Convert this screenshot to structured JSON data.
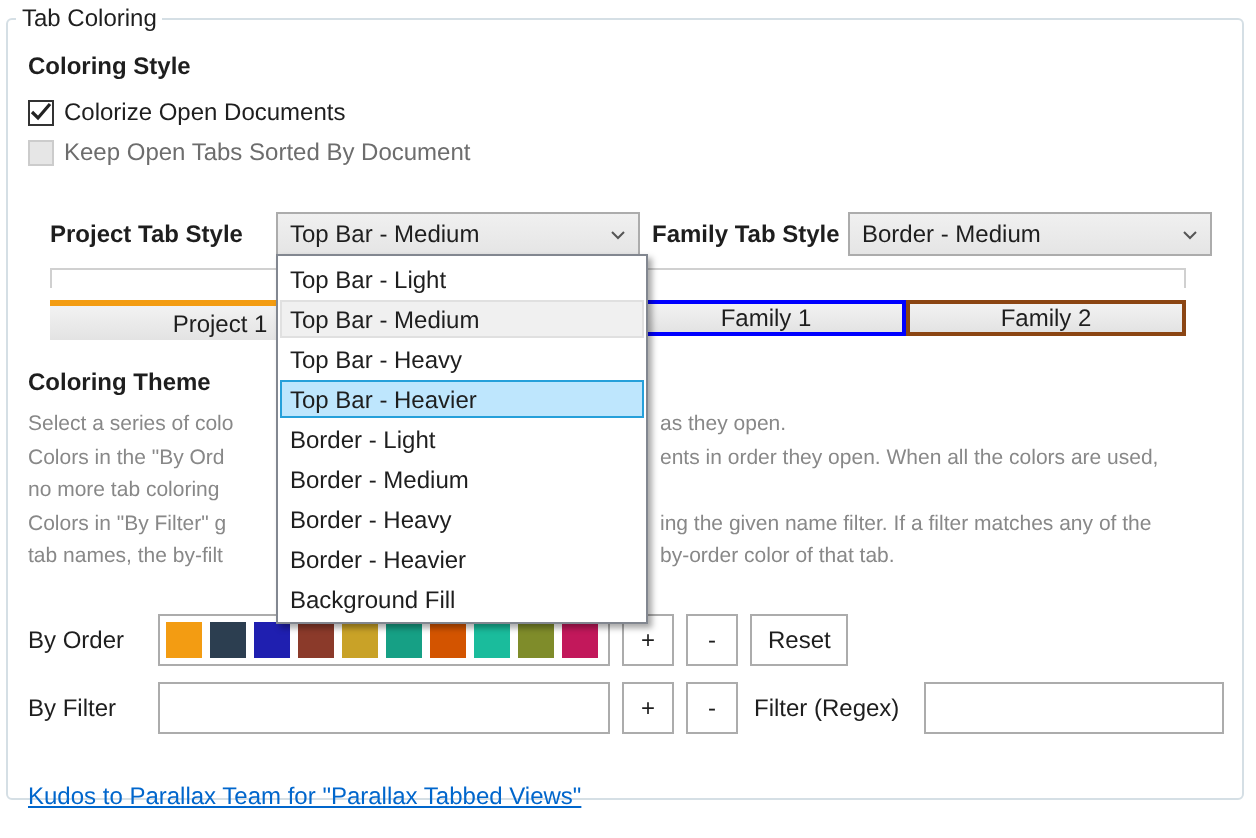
{
  "group": {
    "title": "Tab Coloring"
  },
  "coloring_style": {
    "heading": "Coloring Style",
    "checkboxes": [
      {
        "label": "Colorize Open Documents",
        "checked": true,
        "disabled": false
      },
      {
        "label": "Keep Open Tabs Sorted By Document",
        "checked": false,
        "disabled": true
      }
    ]
  },
  "project_tab_style": {
    "label": "Project Tab Style",
    "value": "Top Bar - Medium",
    "expanded": true,
    "options": [
      {
        "label": "Top Bar - Light",
        "selected": false,
        "highlighted": false
      },
      {
        "label": "Top Bar - Medium",
        "selected": true,
        "highlighted": false
      },
      {
        "label": "Top Bar - Heavy",
        "selected": false,
        "highlighted": false
      },
      {
        "label": "Top Bar - Heavier",
        "selected": false,
        "highlighted": true
      },
      {
        "label": "Border - Light",
        "selected": false,
        "highlighted": false
      },
      {
        "label": "Border - Medium",
        "selected": false,
        "highlighted": false
      },
      {
        "label": "Border - Heavy",
        "selected": false,
        "highlighted": false
      },
      {
        "label": "Border - Heavier",
        "selected": false,
        "highlighted": false
      },
      {
        "label": "Background Fill",
        "selected": false,
        "highlighted": false
      }
    ],
    "preview_tabs": [
      {
        "label": "Project 1",
        "color": "#f39c12"
      }
    ]
  },
  "family_tab_style": {
    "label": "Family Tab Style",
    "value": "Border - Medium",
    "preview_tabs": [
      {
        "label": "Family 1",
        "color": "#0000ff"
      },
      {
        "label": "Family 2",
        "color": "#8b4513"
      }
    ]
  },
  "coloring_theme": {
    "heading": "Coloring Theme",
    "description_lines": [
      {
        "left": "Select a series of colo",
        "right": "as they open."
      },
      {
        "left": "Colors in the \"By Ord",
        "right": "ents in order they open. When all the colors are used,"
      },
      {
        "left": "no more tab coloring"
      },
      {
        "left": "Colors in \"By Filter\" g",
        "right": "ing the given name filter. If a filter matches any of the"
      },
      {
        "left": "tab names, the by-filt",
        "right": "by-order color of that tab."
      }
    ],
    "by_order": {
      "label": "By Order",
      "swatches": [
        {
          "color": "#f39c12"
        },
        {
          "color": "#2c3e50"
        },
        {
          "color": "#1f1fb0"
        },
        {
          "color": "#8b3a2a"
        },
        {
          "color": "#c9a227"
        },
        {
          "color": "#16a085"
        },
        {
          "color": "#d35400"
        },
        {
          "color": "#1abc9c"
        },
        {
          "color": "#7f8c2a"
        },
        {
          "color": "#c2185b"
        }
      ],
      "buttons": [
        "+",
        "-",
        "Reset"
      ]
    },
    "by_filter": {
      "label": "By Filter",
      "buttons": [
        "+",
        "-"
      ],
      "filter_label": "Filter (Regex)"
    }
  },
  "link": "Kudos to Parallax Team for \"Parallax Tabbed Views\""
}
